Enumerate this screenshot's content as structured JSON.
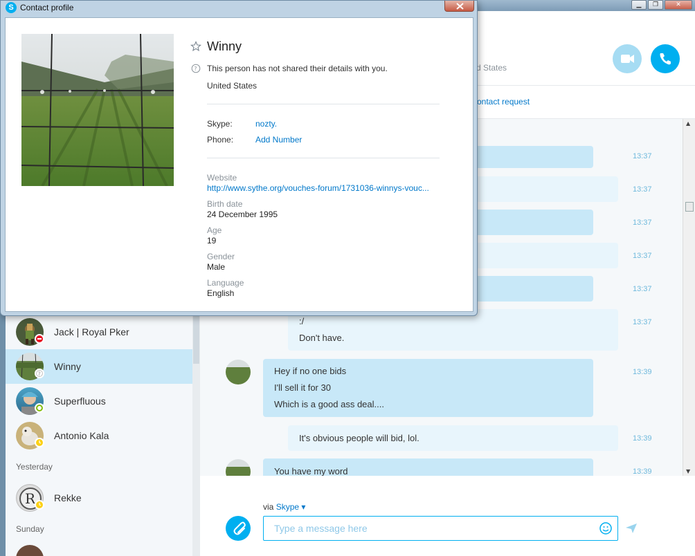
{
  "dialog": {
    "title": "Contact profile",
    "name": "Winny",
    "privacy_note": "This person has not shared their details with you.",
    "country": "United States",
    "skype_label": "Skype:",
    "skype_value": "nozty.",
    "phone_label": "Phone:",
    "phone_value": "Add Number",
    "website_label": "Website",
    "website_value": "http://www.sythe.org/vouches-forum/1731036-winnys-vouc...",
    "birth_label": "Birth date",
    "birth_value": "24 December 1995",
    "age_label": "Age",
    "age_value": "19",
    "gender_label": "Gender",
    "gender_value": "Male",
    "language_label": "Language",
    "language_value": "English"
  },
  "sidebar": {
    "contacts": [
      {
        "name": "Jack | Royal Pker",
        "status": "busy"
      },
      {
        "name": "Winny",
        "status": "unknown"
      },
      {
        "name": "Superfluous",
        "status": "online"
      },
      {
        "name": "Antonio Kala",
        "status": "away"
      }
    ],
    "section_yesterday": "Yesterday",
    "contacts_yesterday": [
      {
        "name": "Rekke",
        "status": "away"
      }
    ],
    "section_sunday": "Sunday"
  },
  "conversation": {
    "header_country": "ted States",
    "contact_request": "ontact request",
    "messages": [
      {
        "time": "13:37",
        "lines": [
          ""
        ]
      },
      {
        "time": "13:37",
        "lines": [
          ""
        ]
      },
      {
        "time": "13:37",
        "lines": [
          ""
        ]
      },
      {
        "time": "13:37",
        "lines": [
          ""
        ]
      },
      {
        "time": "13:37",
        "lines": [
          ""
        ]
      },
      {
        "time": "13:37",
        "lines": [
          ":/",
          "Don't have."
        ]
      },
      {
        "time": "13:39",
        "lines": [
          "Hey if no one bids",
          "I'll sell it for 30",
          "Which is a good ass deal...."
        ]
      },
      {
        "time": "13:39",
        "lines": [
          "It's obvious people will bid, lol."
        ]
      },
      {
        "time": "13:39",
        "lines": [
          "You have my word"
        ]
      }
    ]
  },
  "compose": {
    "via_prefix": "via",
    "via_service": "Skype",
    "placeholder": "Type a message here"
  },
  "colors": {
    "accent": "#00aff0",
    "link": "#0078ca",
    "bubble_in": "#c8e8f8",
    "bubble_out": "#e8f5fc",
    "time": "#6fb9dc"
  }
}
